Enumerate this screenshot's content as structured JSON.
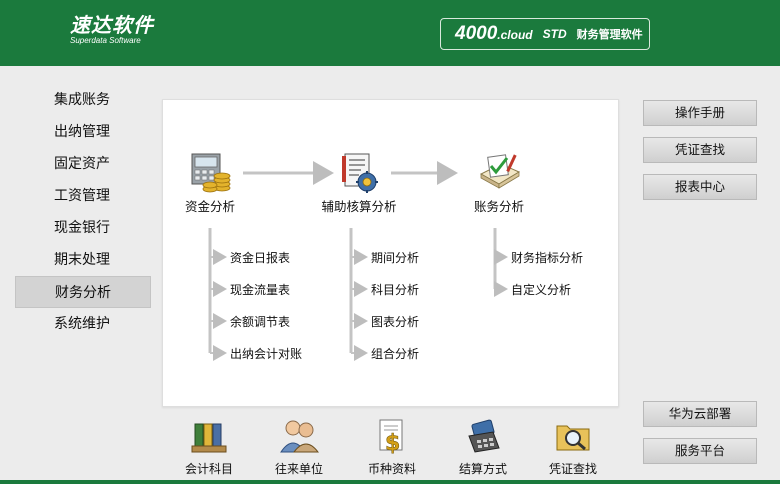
{
  "header": {
    "logo_main": "速达软件",
    "logo_sub": "Superdata Software",
    "version_big": "4000",
    "version_small": ".cloud",
    "edition": "STD",
    "product": "财务管理软件"
  },
  "sidebar": {
    "items": [
      {
        "label": "集成账务"
      },
      {
        "label": "出纳管理"
      },
      {
        "label": "固定资产"
      },
      {
        "label": "工资管理"
      },
      {
        "label": "现金银行"
      },
      {
        "label": "期末处理"
      },
      {
        "label": "财务分析"
      },
      {
        "label": "系统维护"
      }
    ],
    "active_index": 6
  },
  "flow": {
    "nodes": [
      {
        "label": "资金分析",
        "icon": "cash-register-coins-icon",
        "subs": [
          "资金日报表",
          "现金流量表",
          "余额调节表",
          "出纳会计对账"
        ]
      },
      {
        "label": "辅助核算分析",
        "icon": "document-gear-icon",
        "subs": [
          "期间分析",
          "科目分析",
          "图表分析",
          "组合分析"
        ]
      },
      {
        "label": "账务分析",
        "icon": "ledger-check-icon",
        "subs": [
          "财务指标分析",
          "自定义分析"
        ]
      }
    ]
  },
  "right_buttons": {
    "top": [
      "操作手册",
      "凭证查找",
      "报表中心"
    ],
    "bottom": [
      "华为云部署",
      "服务平台"
    ]
  },
  "bottom_toolbar": [
    {
      "label": "会计科目",
      "icon": "binders-icon"
    },
    {
      "label": "往来单位",
      "icon": "people-icon"
    },
    {
      "label": "币种资料",
      "icon": "currency-document-icon"
    },
    {
      "label": "结算方式",
      "icon": "card-terminal-icon"
    },
    {
      "label": "凭证查找",
      "icon": "folder-search-icon"
    }
  ],
  "colors": {
    "brand_green": "#1b7a3d",
    "active_item": "#d3d3d3"
  }
}
